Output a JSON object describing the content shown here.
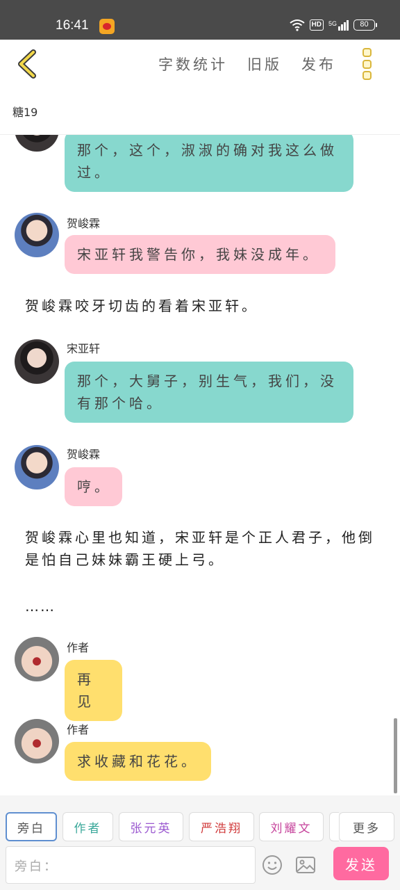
{
  "status_bar": {
    "time": "16:41",
    "hd_badge": "HD",
    "network": "5G",
    "battery": "80",
    "icons": [
      "weibo-icon",
      "wifi-icon",
      "signal-icon",
      "battery-icon"
    ]
  },
  "toolbar": {
    "word_count": "字数统计",
    "old_version": "旧版",
    "publish": "发布"
  },
  "story_title": "糖19",
  "messages": {
    "m1": {
      "text": "那个，这个，淑淑的确对我这么做过。"
    },
    "m2": {
      "name": "贺峻霖",
      "text": "宋亚轩我警告你，我妹没成年。"
    },
    "n1": {
      "text": "贺峻霖咬牙切齿的看着宋亚轩。"
    },
    "m3": {
      "name": "宋亚轩",
      "text": "那个，大舅子，别生气，我们，没有那个哈。"
    },
    "m4": {
      "name": "贺峻霖",
      "text": "哼。"
    },
    "n2": {
      "text": "贺峻霖心里也知道，宋亚轩是个正人君子，他倒是怕自己妹妹霸王硬上弓。"
    },
    "n3": {
      "text": "……"
    },
    "m5": {
      "name": "作者",
      "text": "再见"
    },
    "m6": {
      "name": "作者",
      "text": "求收藏和花花。"
    }
  },
  "role_chips": [
    {
      "label": "旁白",
      "color": "#555555"
    },
    {
      "label": "作者",
      "color": "#3aa89a"
    },
    {
      "label": "张元英",
      "color": "#9b59d0"
    },
    {
      "label": "严浩翔",
      "color": "#d0393a"
    },
    {
      "label": "刘耀文",
      "color": "#c6449c"
    },
    {
      "label": "更多",
      "color": "#555555"
    }
  ],
  "input": {
    "placeholder": "旁白："
  },
  "send_label": "发送",
  "colors": {
    "teal_bubble": "#87d8ce",
    "pink_bubble": "#ffc9d5",
    "yellow_bubble": "#ffdf6e",
    "send_button": "#ff6aa0"
  }
}
